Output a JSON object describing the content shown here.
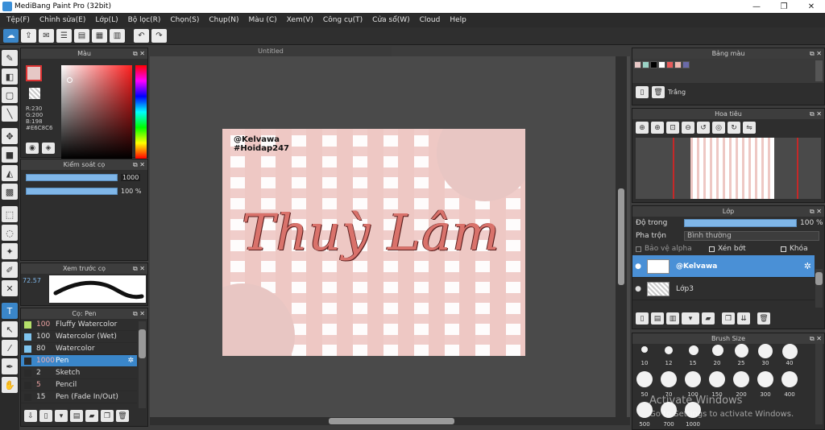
{
  "window": {
    "title": "MediBang Paint Pro (32bit)",
    "min": "—",
    "restore": "❐",
    "close": "✕"
  },
  "menu": [
    "Tệp(F)",
    "Chỉnh sửa(E)",
    "Lớp(L)",
    "Bộ lọc(R)",
    "Chọn(S)",
    "Chụp(N)",
    "Màu (C)",
    "Xem(V)",
    "Công cụ(T)",
    "Cửa sổ(W)",
    "Cloud",
    "Help"
  ],
  "document": {
    "tab": "Untitled",
    "handle_line1": "@Kelvawa",
    "handle_line2": "#Hoidap247",
    "script_text": "Thuỳ Lâm"
  },
  "color_panel": {
    "title": "Màu",
    "r": "R:230",
    "g": "G:200",
    "b": "B:198",
    "hex": "#E6C8C6"
  },
  "brush_control": {
    "title": "Kiểm soát cọ",
    "size": "1000",
    "opacity": "100 %"
  },
  "preview": {
    "title": "Xem trước cọ",
    "zoom": "72.57"
  },
  "brush_panel": {
    "title": "Cọ: Pen",
    "items": [
      {
        "size": "100",
        "name": "Fluffy Watercolor",
        "color": "#b5e06a",
        "size_color": "#e9a0a0"
      },
      {
        "size": "100",
        "name": "Watercolor (Wet)",
        "color": "#7fc4ee",
        "size_color": "#dddddd"
      },
      {
        "size": "80",
        "name": "Watercolor",
        "color": "#7fc4ee",
        "size_color": "#dddddd"
      },
      {
        "size": "1000",
        "name": "Pen",
        "color": "#2a2a2a",
        "size_color": "#e9a0a0"
      },
      {
        "size": "2",
        "name": "Sketch",
        "color": "#2a2a2a",
        "size_color": "#dddddd"
      },
      {
        "size": "5",
        "name": "Pencil",
        "color": "#2a2a2a",
        "size_color": "#e9a0a0"
      },
      {
        "size": "15",
        "name": "Pen (Fade In/Out)",
        "color": "#2a2a2a",
        "size_color": "#dddddd"
      }
    ]
  },
  "palette_panel": {
    "title": "Bảng màu",
    "swatches": [
      "#e8c8c6",
      "#9bd3c6",
      "#000000",
      "#ffffff",
      "#e85a5a",
      "#f0b8b0",
      "#6a6aa8"
    ],
    "label": "Trắng"
  },
  "navigator": {
    "title": "Hoa tiêu"
  },
  "layer_panel": {
    "title": "Lớp",
    "opacity_label": "Độ trong",
    "opacity_value": "100 %",
    "blend_label": "Pha trộn",
    "blend_value": "Bình thường",
    "protect_alpha": "Bảo vệ alpha",
    "clipping": "Xén bớt",
    "lock": "Khóa",
    "layers": [
      {
        "name": "@Kelvawa"
      },
      {
        "name": "Lớp3"
      }
    ]
  },
  "brush_size": {
    "title": "Brush Size",
    "row1": [
      "10",
      "12",
      "15",
      "20",
      "25",
      "30",
      "40"
    ],
    "row2": [
      "50",
      "70",
      "100",
      "150",
      "200",
      "300",
      "400"
    ],
    "row3": [
      "500",
      "700",
      "1000"
    ]
  },
  "watermark": {
    "line1": "Activate Windows",
    "line2": "Go to Settings to activate Windows."
  }
}
